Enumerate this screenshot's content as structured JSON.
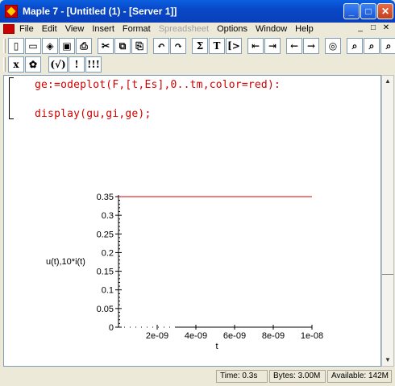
{
  "window": {
    "title": "Maple 7 - [Untitled (1) - [Server 1]]",
    "controls": [
      "_",
      "□",
      "✕"
    ]
  },
  "menu": {
    "items": [
      {
        "label": "File",
        "enabled": true
      },
      {
        "label": "Edit",
        "enabled": true
      },
      {
        "label": "View",
        "enabled": true
      },
      {
        "label": "Insert",
        "enabled": true
      },
      {
        "label": "Format",
        "enabled": true
      },
      {
        "label": "Spreadsheet",
        "enabled": false
      },
      {
        "label": "Options",
        "enabled": true
      },
      {
        "label": "Window",
        "enabled": true
      },
      {
        "label": "Help",
        "enabled": true
      }
    ],
    "mdi_controls": [
      "_",
      "□",
      "✕"
    ]
  },
  "toolbar1": {
    "groups": [
      [
        {
          "icon": "new-document-icon",
          "glyph": "▯"
        },
        {
          "icon": "open-folder-icon",
          "glyph": "▭"
        },
        {
          "icon": "open-url-icon",
          "glyph": "◈"
        },
        {
          "icon": "save-icon",
          "glyph": "▣"
        },
        {
          "icon": "print-icon",
          "glyph": "⎙"
        }
      ],
      [
        {
          "icon": "cut-icon",
          "glyph": "✂"
        },
        {
          "icon": "copy-icon",
          "glyph": "⧉"
        },
        {
          "icon": "paste-icon",
          "glyph": "⎘"
        }
      ],
      [
        {
          "icon": "undo-icon",
          "glyph": "↶"
        },
        {
          "icon": "redo-icon",
          "glyph": "↷"
        }
      ],
      [
        {
          "icon": "sum-icon",
          "glyph": "Σ"
        },
        {
          "icon": "text-icon",
          "glyph": "T"
        },
        {
          "icon": "insert-input-icon",
          "glyph": "[>"
        }
      ],
      [
        {
          "icon": "outdent-icon",
          "glyph": "⇤"
        },
        {
          "icon": "indent-icon",
          "glyph": "⇥"
        }
      ],
      [
        {
          "icon": "back-icon",
          "glyph": "←"
        },
        {
          "icon": "forward-icon",
          "glyph": "→"
        }
      ],
      [
        {
          "icon": "stop-icon",
          "glyph": "◎"
        }
      ],
      [
        {
          "icon": "zoom-in-icon",
          "glyph": "⌕"
        },
        {
          "icon": "zoom-out-icon",
          "glyph": "⌕"
        },
        {
          "icon": "zoom-icon",
          "glyph": "⌕"
        }
      ]
    ]
  },
  "toolbar2": {
    "buttons": [
      {
        "icon": "math-mode-icon",
        "glyph": "x"
      },
      {
        "icon": "maple-leaf-icon",
        "glyph": "✿"
      },
      {
        "icon": "check-syntax-icon",
        "glyph": "(√)"
      },
      {
        "icon": "execute-icon",
        "glyph": "!"
      },
      {
        "icon": "execute-all-icon",
        "glyph": "!!!"
      }
    ]
  },
  "worksheet": {
    "lines": [
      {
        "text": "ge:=odeplot(F,[t,Es],0..tm,color=red):"
      },
      {
        "text": "display(gu,gi,ge);"
      }
    ],
    "accent_color": "#d00000"
  },
  "chart_data": {
    "type": "line",
    "xlabel": "t",
    "ylabel": "u(t),10*i(t)",
    "xlim": [
      0,
      1e-08
    ],
    "ylim": [
      0,
      0.35
    ],
    "xticks": [
      "2e-09",
      "4e-09",
      "6e-09",
      "8e-09",
      "1e-08"
    ],
    "xtick_values": [
      2e-09,
      4e-09,
      6e-09,
      8e-09,
      1e-08
    ],
    "yticks": [
      "0",
      "0.05",
      "0.1",
      "0.15",
      "0.2",
      "0.25",
      "0.3",
      "0.35"
    ],
    "ytick_values": [
      0,
      0.05,
      0.1,
      0.15,
      0.2,
      0.25,
      0.3,
      0.35
    ],
    "series": [
      {
        "color": "#d00000",
        "x": [
          0,
          1e-08
        ],
        "y": [
          0.35,
          0.35
        ]
      }
    ]
  },
  "status": {
    "time_label": "Time:",
    "time_value": "0.3s",
    "bytes_label": "Bytes:",
    "bytes_value": "3.00M",
    "available_label": "Available:",
    "available_value": "142M"
  }
}
